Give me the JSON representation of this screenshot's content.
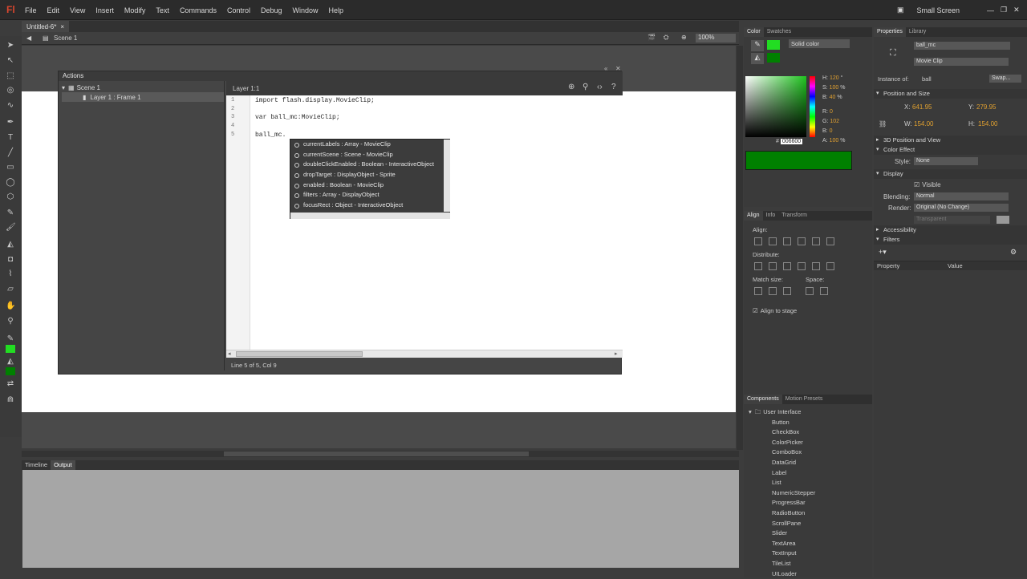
{
  "app": {
    "logo": "Fl",
    "menus": [
      "File",
      "Edit",
      "View",
      "Insert",
      "Modify",
      "Text",
      "Commands",
      "Control",
      "Debug",
      "Window",
      "Help"
    ],
    "workspace": "Small Screen"
  },
  "document": {
    "tab": "Untitled-6*",
    "scene": "Scene 1",
    "zoom": "100%"
  },
  "actions": {
    "title": "Actions",
    "tree": [
      "Scene 1",
      "Layer 1 : Frame 1"
    ],
    "editor_label": "Layer 1:1",
    "line_numbers": [
      "1",
      "2",
      "3",
      "4",
      "5"
    ],
    "code_lines": [
      "import flash.display.MovieClip;",
      "",
      "var ball_mc:MovieClip;",
      "",
      "ball_mc."
    ],
    "status": "Line 5 of 5, Col 9"
  },
  "autocomplete": {
    "items": [
      "currentLabels : Array - MovieClip",
      "currentScene : Scene - MovieClip",
      "doubleClickEnabled : Boolean - InteractiveObject",
      "dropTarget : DisplayObject - Sprite",
      "enabled : Boolean - MovieClip",
      "filters : Array - DisplayObject",
      "focusRect : Object - InteractiveObject"
    ]
  },
  "bottom": {
    "tabs": [
      "Timeline",
      "Output"
    ]
  },
  "color_panel": {
    "tabs": [
      "Color",
      "Swatches"
    ],
    "fill_type": "Solid color",
    "h": "120",
    "h_unit": "°",
    "s": "100",
    "s_unit": "%",
    "b": "40",
    "b_unit": "%",
    "r": "0",
    "g": "102",
    "bv": "0",
    "hex": "006600",
    "alpha": "100",
    "alpha_unit": "%",
    "fill_color": "#008000",
    "stroke_color": "#22dd22"
  },
  "align_panel": {
    "tabs": [
      "Align",
      "Info",
      "Transform"
    ],
    "align_label": "Align:",
    "distribute_label": "Distribute:",
    "match_label": "Match size:",
    "space_label": "Space:",
    "align_to_stage": "Align to stage"
  },
  "components": {
    "tabs": [
      "Components",
      "Motion Presets"
    ],
    "folder": "User Interface",
    "items": [
      "Button",
      "CheckBox",
      "ColorPicker",
      "ComboBox",
      "DataGrid",
      "Label",
      "List",
      "NumericStepper",
      "ProgressBar",
      "RadioButton",
      "ScrollPane",
      "Slider",
      "TextArea",
      "TextInput",
      "TileList",
      "UILoader"
    ]
  },
  "properties": {
    "tabs": [
      "Properties",
      "Library"
    ],
    "instance_name": "ball_mc",
    "symbol_type": "Movie Clip",
    "instance_of_label": "Instance of:",
    "instance_of": "ball",
    "swap_label": "Swap...",
    "sections": {
      "pos_size": "Position and Size",
      "pos3d": "3D Position and View",
      "color_effect": "Color Effect",
      "display": "Display",
      "accessibility": "Accessibility",
      "filters": "Filters"
    },
    "x": "641.95",
    "y": "279.95",
    "w": "154.00",
    "h": "154.00",
    "style_label": "Style:",
    "style": "None",
    "visible_label": "Visible",
    "blending_label": "Blending:",
    "blending": "Normal",
    "render_label": "Render:",
    "render": "Original (No Change)",
    "transparent": "Transparent",
    "filter_cols": [
      "Property",
      "Value"
    ]
  }
}
